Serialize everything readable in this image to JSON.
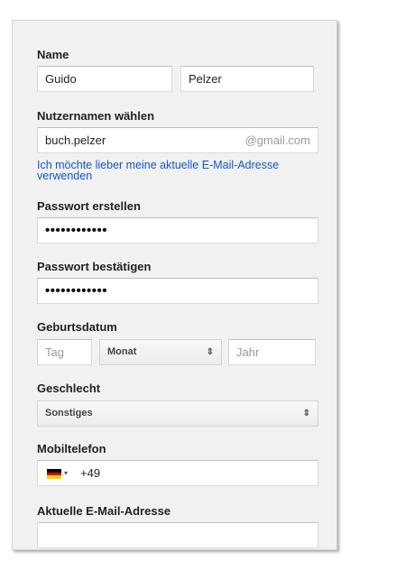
{
  "form": {
    "name": {
      "label": "Name",
      "first": "Guido",
      "last": "Pelzer"
    },
    "username": {
      "label": "Nutzernamen wählen",
      "value": "buch.pelzer",
      "suffix": "@gmail.com",
      "alt_link": "Ich möchte lieber meine aktuelle E-Mail-Adresse verwenden"
    },
    "password": {
      "label": "Passwort erstellen",
      "masked": "••••••••••••"
    },
    "password_confirm": {
      "label": "Passwort bestätigen",
      "masked": "••••••••••••"
    },
    "birthday": {
      "label": "Geburtsdatum",
      "day_placeholder": "Tag",
      "month_value": "Monat",
      "year_placeholder": "Jahr"
    },
    "gender": {
      "label": "Geschlecht",
      "value": "Sonstiges"
    },
    "mobile": {
      "label": "Mobiltelefon",
      "country": "Germany",
      "value": "+49"
    },
    "current_email": {
      "label": "Aktuelle E-Mail-Adresse",
      "value": ""
    }
  },
  "icons": {
    "updown": "⇕",
    "caret": "▾"
  },
  "colors": {
    "link": "#1155cc",
    "flag_black": "#000000",
    "flag_red": "#dd0000",
    "flag_gold": "#ffce00"
  }
}
